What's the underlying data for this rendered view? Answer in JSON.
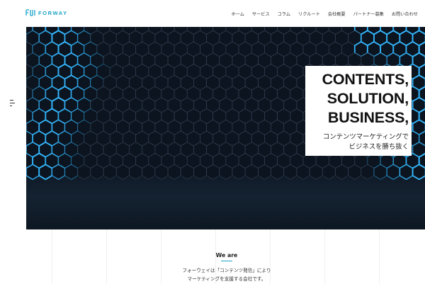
{
  "brand": {
    "logo_text": "FORWAY",
    "accent": "#1aa3c9"
  },
  "nav": {
    "items": [
      "ホーム",
      "サービス",
      "コラム",
      "リクルート",
      "会社概要",
      "パートナー募集",
      "お問い合わせ"
    ]
  },
  "hero": {
    "headline": [
      "CONTENTS,",
      "SOLUTION,",
      "BUSINESS,"
    ],
    "subline": [
      "コンテンツマーケティングで",
      "ビジネスを勝ち抜く"
    ],
    "background_color": "#0b1420",
    "glow_color": "#35b8ff"
  },
  "about": {
    "heading": "We are",
    "lines": [
      "フォーウェイは「コンテンツ発信」により",
      "マーケティングを支援する会社です。"
    ]
  }
}
